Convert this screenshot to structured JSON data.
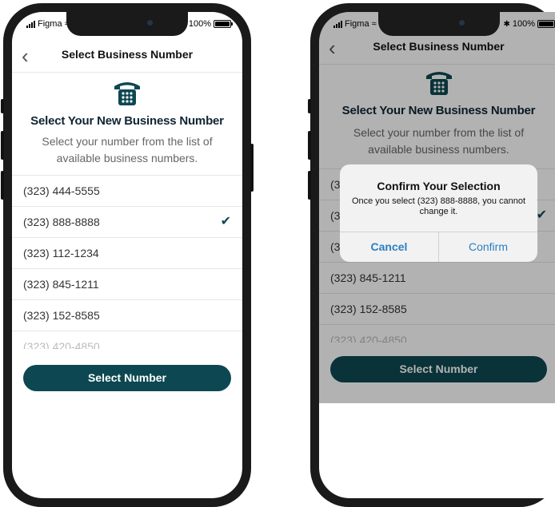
{
  "status": {
    "carrier": "Figma",
    "battery": "100%"
  },
  "nav": {
    "back_icon": "chevron-left-icon",
    "title": "Select Business Number"
  },
  "header": {
    "heading": "Select Your New Business Number",
    "subtext": "Select your number from the list of available business numbers."
  },
  "numbers": [
    {
      "value": "(323) 444-5555",
      "selected": false
    },
    {
      "value": "(323) 888-8888",
      "selected": true
    },
    {
      "value": "(323) 112-1234",
      "selected": false
    },
    {
      "value": "(323) 845-1211",
      "selected": false
    },
    {
      "value": "(323) 152-8585",
      "selected": false
    },
    {
      "value": "(323) 420-4850",
      "selected": false
    }
  ],
  "select_button": "Select Number",
  "dialog": {
    "title": "Confirm Your Selection",
    "message": "Once you select (323) 888-8888,  you cannot change it.",
    "cancel": "Cancel",
    "confirm": "Confirm"
  },
  "colors": {
    "primary": "#0d4852",
    "dialog_action": "#2a7fc4",
    "overlay": "rgba(0,0,0,0.30)"
  }
}
